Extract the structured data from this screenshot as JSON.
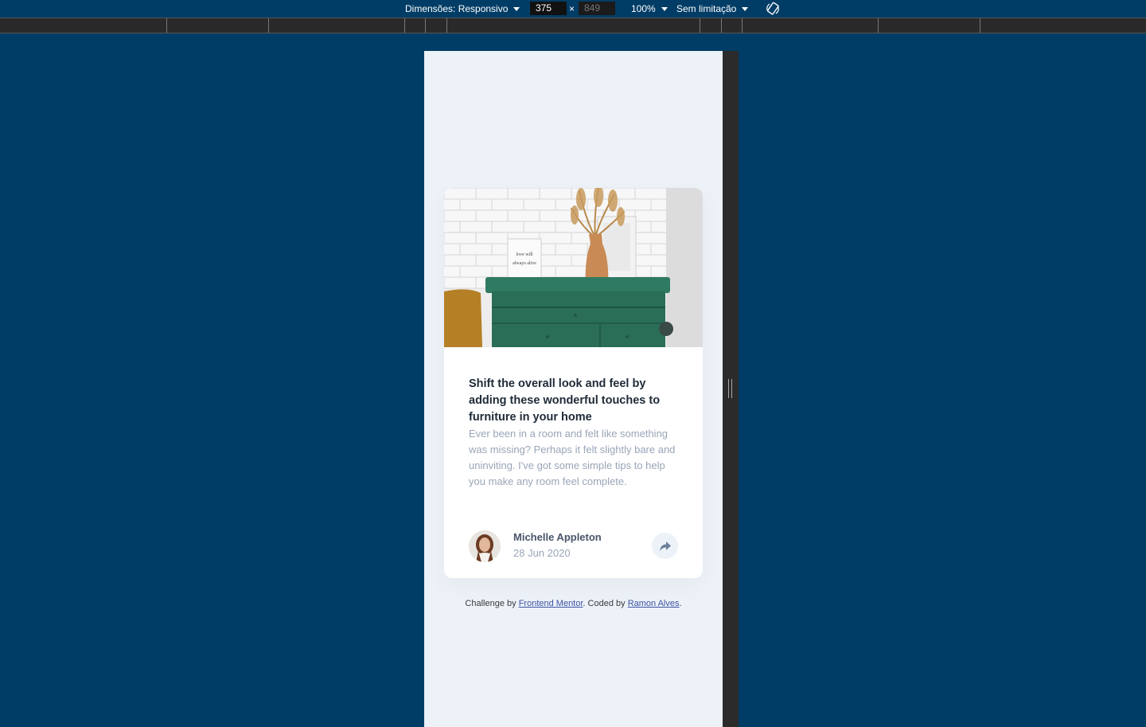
{
  "toolbar": {
    "dimensions_label": "Dimensões: Responsivo",
    "width_value": "375",
    "height_placeholder": "849",
    "times": "×",
    "zoom": "100%",
    "throttle": "Sem limitação"
  },
  "card": {
    "title": "Shift the overall look and feel by adding these wonderful touches to furniture in your home",
    "description": "Ever been in a room and felt like something was missing? Perhaps it felt slightly bare and uninviting. I've got some simple tips to help you make any room feel complete.",
    "author_name": "Michelle Appleton",
    "author_date": "28 Jun 2020",
    "frame_text": "love will always alive"
  },
  "attribution": {
    "prefix": "Challenge by ",
    "link1": "Frontend Mentor",
    "middle": ". Coded by ",
    "link2": "Ramon Alves",
    "suffix": "."
  },
  "colors": {
    "page_bg": "#003d66",
    "viewport_bg": "#ecf2f8",
    "cabinet": "#2f7a62",
    "title": "#1e2a38",
    "muted": "#9aa5b8"
  }
}
